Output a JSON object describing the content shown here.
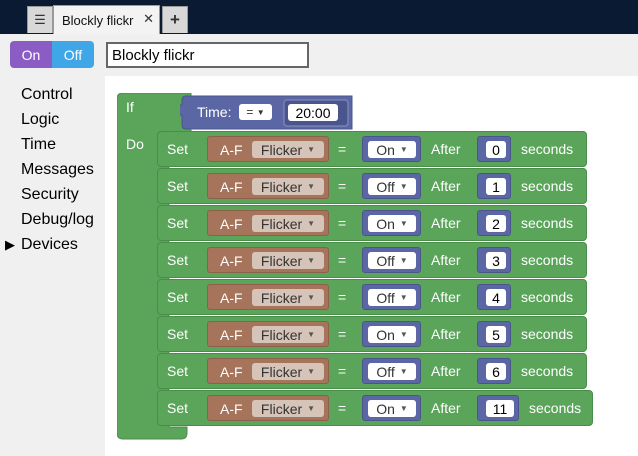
{
  "tab": {
    "title": "Blockly flickr",
    "menu_icon": "hamburger-icon",
    "close_glyph": "✕",
    "add_glyph": "+"
  },
  "toggle": {
    "on_label": "On",
    "off_label": "Off"
  },
  "script_name": {
    "value": "Blockly flickr"
  },
  "sidebar": {
    "items": [
      {
        "label": "Control"
      },
      {
        "label": "Logic"
      },
      {
        "label": "Time"
      },
      {
        "label": "Messages"
      },
      {
        "label": "Security"
      },
      {
        "label": "Debug/log"
      },
      {
        "label": "Devices",
        "arrow": "▶"
      }
    ]
  },
  "if_block": {
    "if_label": "If",
    "do_label": "Do",
    "time_label": "Time:",
    "operator": "=",
    "time_value": "20:00"
  },
  "set_rows": [
    {
      "set": "Set",
      "device": "A-F",
      "prop": "Flicker",
      "eq": "=",
      "state": "On",
      "after": "After",
      "delay": "0",
      "unit": "seconds"
    },
    {
      "set": "Set",
      "device": "A-F",
      "prop": "Flicker",
      "eq": "=",
      "state": "Off",
      "after": "After",
      "delay": "1",
      "unit": "seconds"
    },
    {
      "set": "Set",
      "device": "A-F",
      "prop": "Flicker",
      "eq": "=",
      "state": "On",
      "after": "After",
      "delay": "2",
      "unit": "seconds"
    },
    {
      "set": "Set",
      "device": "A-F",
      "prop": "Flicker",
      "eq": "=",
      "state": "Off",
      "after": "After",
      "delay": "3",
      "unit": "seconds"
    },
    {
      "set": "Set",
      "device": "A-F",
      "prop": "Flicker",
      "eq": "=",
      "state": "Off",
      "after": "After",
      "delay": "4",
      "unit": "seconds"
    },
    {
      "set": "Set",
      "device": "A-F",
      "prop": "Flicker",
      "eq": "=",
      "state": "On",
      "after": "After",
      "delay": "5",
      "unit": "seconds"
    },
    {
      "set": "Set",
      "device": "A-F",
      "prop": "Flicker",
      "eq": "=",
      "state": "Off",
      "after": "After",
      "delay": "6",
      "unit": "seconds"
    },
    {
      "set": "Set",
      "device": "A-F",
      "prop": "Flicker",
      "eq": "=",
      "state": "On",
      "after": "After",
      "delay": "11",
      "unit": "seconds"
    }
  ],
  "colors": {
    "control_green": "#5ba55b",
    "time_purple": "#5b67a5",
    "device_brown": "#a5745b",
    "field_bg": "#ffffff",
    "dropdown_bg": "#d6c4b8"
  }
}
